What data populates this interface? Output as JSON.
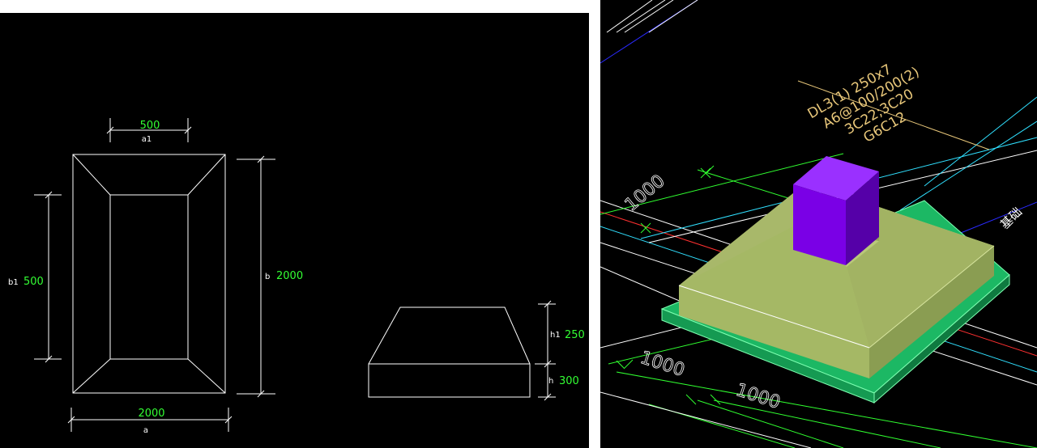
{
  "left_drawing": {
    "plan": {
      "a1_value": "500",
      "a1_label": "a1",
      "b1_label": "b1",
      "b1_value": "500",
      "b_label": "b",
      "b_value": "2000",
      "a_value": "2000",
      "a_label": "a"
    },
    "section": {
      "h1_label": "h1",
      "h1_value": "250",
      "h_label": "h",
      "h_value": "300"
    }
  },
  "right_view": {
    "beam_annotation": {
      "line1": "DL3(1) 250x7",
      "line2": "A6@100/200(2)",
      "line3": "3C22;3C20",
      "line4": "G6C12"
    },
    "dimensions": {
      "dim_top": "1000",
      "dim_bottom_left": "1000",
      "dim_bottom_right": "1000"
    },
    "edge_text": "基础"
  },
  "colors": {
    "background": "#000000",
    "cad_line": "#ffffff",
    "dimension_value": "#33ff33",
    "column": "#7a00e6",
    "footing": "#a5b865",
    "pad": "#2ee07a",
    "annotation": "#e8c77a"
  }
}
